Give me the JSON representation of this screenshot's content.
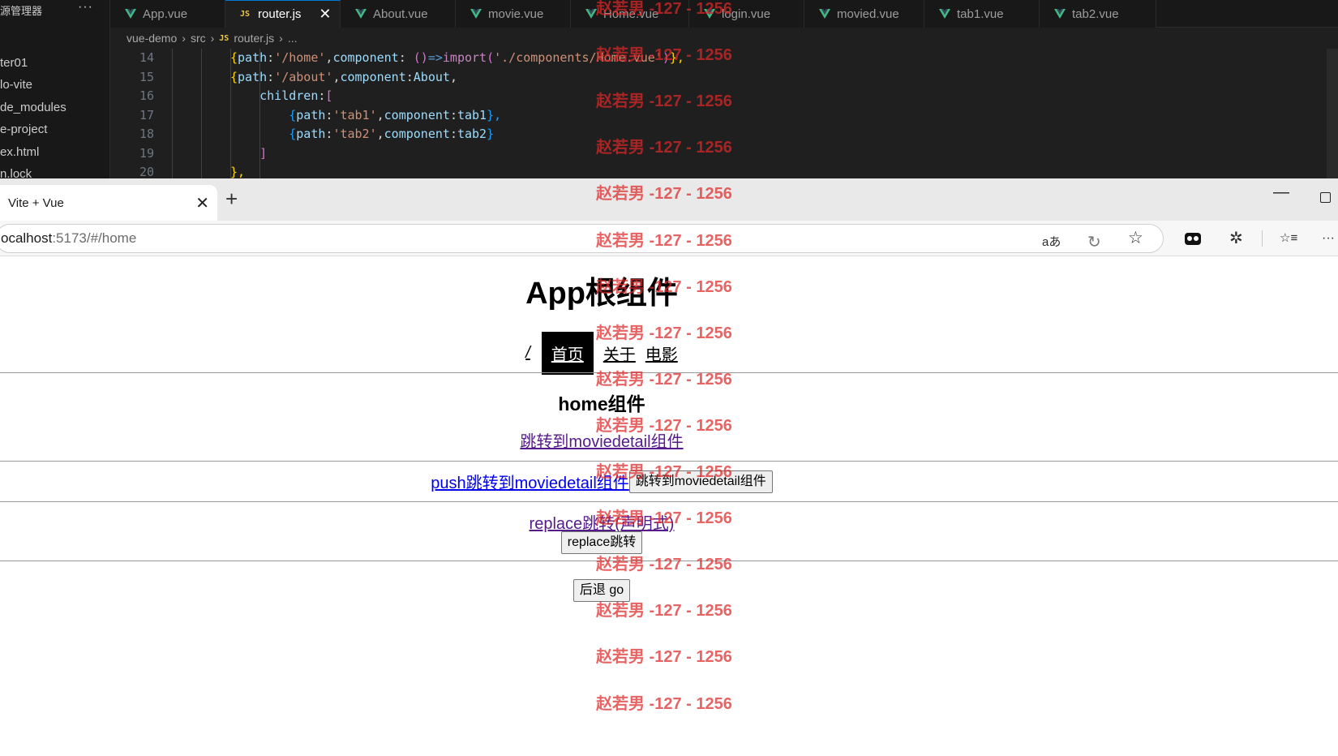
{
  "vscode": {
    "explorer": {
      "title": "源管理器",
      "more": "···",
      "items": [
        "ter01",
        "lo-vite",
        "de_modules",
        "e-project",
        "ex.html",
        "n.lock"
      ]
    },
    "tabs": [
      {
        "label": "App.vue",
        "kind": "vue"
      },
      {
        "label": "router.js",
        "kind": "js",
        "active": true
      },
      {
        "label": "About.vue",
        "kind": "vue"
      },
      {
        "label": "movie.vue",
        "kind": "vue"
      },
      {
        "label": "Home.vue",
        "kind": "vue"
      },
      {
        "label": "login.vue",
        "kind": "vue"
      },
      {
        "label": "movied.vue",
        "kind": "vue"
      },
      {
        "label": "tab1.vue",
        "kind": "vue"
      },
      {
        "label": "tab2.vue",
        "kind": "vue"
      }
    ],
    "tab_close": "✕",
    "js_badge": "JS",
    "breadcrumb": [
      "vue-demo",
      "src",
      "router.js",
      "..."
    ],
    "line_numbers": [
      "14",
      "15",
      "16",
      "17",
      "18",
      "19",
      "20"
    ],
    "code_lines": [
      [
        [
          "{",
          "#ffd700"
        ],
        [
          "path",
          "#9cdcfe"
        ],
        [
          ":",
          "#d4d4d4"
        ],
        [
          "'/home'",
          "#ce9178"
        ],
        [
          ",",
          "#d4d4d4"
        ],
        [
          "component",
          "#9cdcfe"
        ],
        [
          ": ",
          "#d4d4d4"
        ],
        [
          "()",
          "#da70d6"
        ],
        [
          "=>",
          "#569cd6"
        ],
        [
          "import",
          "#c586c0"
        ],
        [
          "(",
          "#da70d6"
        ],
        [
          "'./components/Home.vue'",
          "#ce9178"
        ],
        [
          ")",
          "#da70d6"
        ],
        [
          "},",
          "#ffd700"
        ]
      ],
      [
        [
          "{",
          "#ffd700"
        ],
        [
          "path",
          "#9cdcfe"
        ],
        [
          ":",
          "#d4d4d4"
        ],
        [
          "'/about'",
          "#ce9178"
        ],
        [
          ",",
          "#d4d4d4"
        ],
        [
          "component",
          "#9cdcfe"
        ],
        [
          ":",
          "#d4d4d4"
        ],
        [
          "About",
          "#9cdcfe"
        ],
        [
          ",",
          "#d4d4d4"
        ]
      ],
      [
        [
          "    children",
          "#9cdcfe"
        ],
        [
          ":",
          "#d4d4d4"
        ],
        [
          "[",
          "#da70d6"
        ]
      ],
      [
        [
          "        {",
          "#179fff"
        ],
        [
          "path",
          "#9cdcfe"
        ],
        [
          ":",
          "#d4d4d4"
        ],
        [
          "'tab1'",
          "#ce9178"
        ],
        [
          ",",
          "#d4d4d4"
        ],
        [
          "component",
          "#9cdcfe"
        ],
        [
          ":",
          "#d4d4d4"
        ],
        [
          "tab1",
          "#9cdcfe"
        ],
        [
          "},",
          "#179fff"
        ]
      ],
      [
        [
          "        {",
          "#179fff"
        ],
        [
          "path",
          "#9cdcfe"
        ],
        [
          ":",
          "#d4d4d4"
        ],
        [
          "'tab2'",
          "#ce9178"
        ],
        [
          ",",
          "#d4d4d4"
        ],
        [
          "component",
          "#9cdcfe"
        ],
        [
          ":",
          "#d4d4d4"
        ],
        [
          "tab2",
          "#9cdcfe"
        ],
        [
          "}",
          "#179fff"
        ]
      ],
      [
        [
          "    ]",
          "#da70d6"
        ]
      ],
      [
        [
          "},",
          "#ffd700"
        ]
      ]
    ]
  },
  "browser": {
    "tab_title": "Vite + Vue",
    "tab_close": "✕",
    "new_tab": "+",
    "window_min": "—",
    "url_host": "ocalhost",
    "url_rest": ":5173/#/home",
    "toolbar_icons": {
      "read_aloud": "aあ",
      "refresh_edge": "↻",
      "favorite": "☆",
      "extensions": "✲",
      "collections": "☆≡",
      "more": "···"
    }
  },
  "page": {
    "app_title": "App根组件",
    "nav": {
      "slash": "/",
      "home": "首页",
      "about": "关于",
      "movie": "电影"
    },
    "home_title": "home组件",
    "link_moviedetail": "跳转到moviedetail组件",
    "link_push": "push跳转到moviedetail组件",
    "button_moviedetail": "跳转到moviedetail组件",
    "link_replace": "replace跳转(声明式)",
    "button_replace": "replace跳转",
    "button_go": "后退 go"
  },
  "watermark": {
    "text": "赵若男 -127 - 1256",
    "count": 16
  },
  "colors": {
    "vscode_bg": "#1e1e1e",
    "vue_green": "#42b883",
    "active_tab_border": "#0078d4",
    "watermark": "#dc2828",
    "link_visited": "#551a8b",
    "link": "#0000ee"
  }
}
